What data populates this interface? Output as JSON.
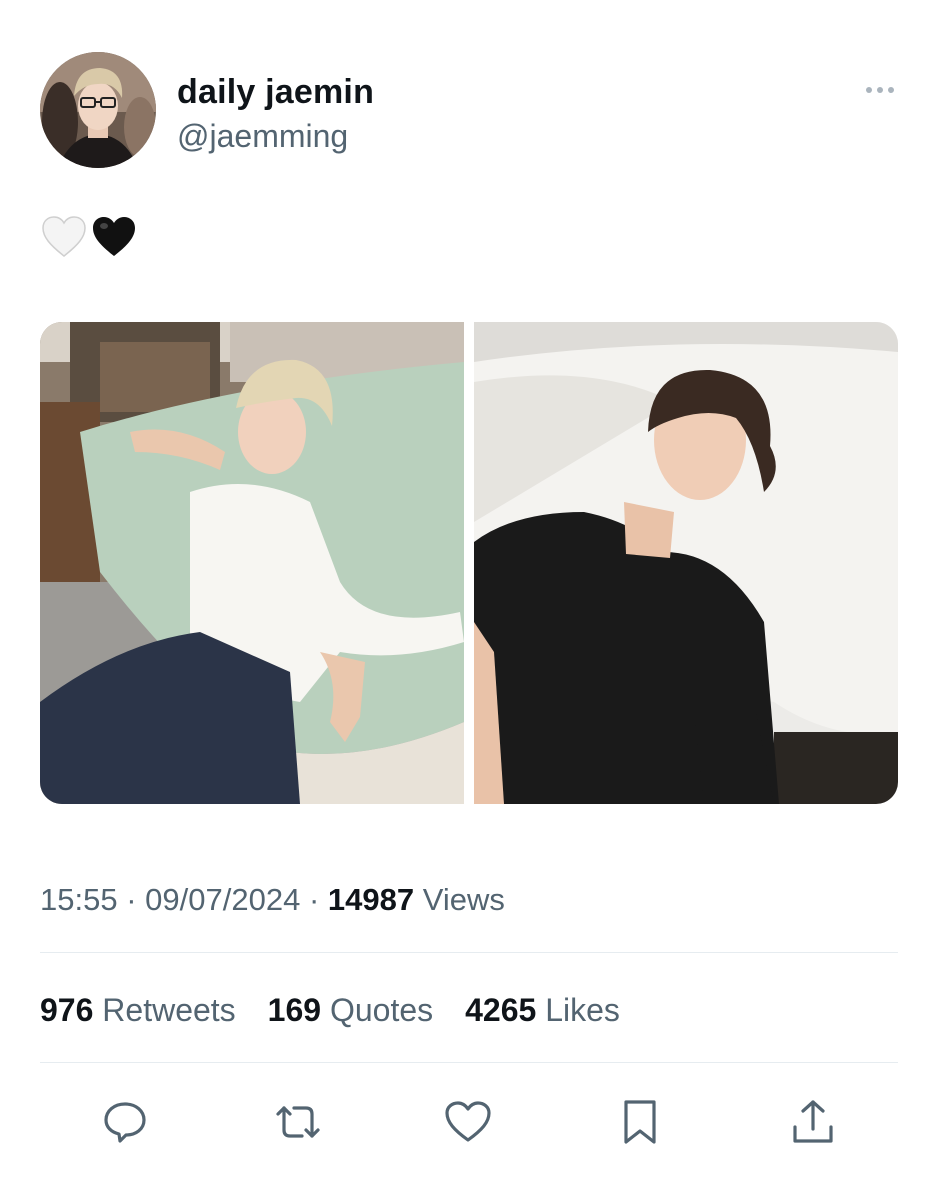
{
  "user": {
    "display_name": "daily jaemin",
    "handle": "@jaemming"
  },
  "tweet": {
    "text": "🤍🖤",
    "emojis": [
      "white-heart",
      "black-heart"
    ]
  },
  "media": [
    {
      "name": "photo-1"
    },
    {
      "name": "photo-2"
    }
  ],
  "meta": {
    "time": "15:55",
    "separator": "·",
    "date": "09/07/2024",
    "views_count": "14987",
    "views_label": "Views"
  },
  "stats": {
    "retweets_count": "976",
    "retweets_label": "Retweets",
    "quotes_count": "169",
    "quotes_label": "Quotes",
    "likes_count": "4265",
    "likes_label": "Likes"
  },
  "actions": [
    "reply-icon",
    "retweet-icon",
    "like-icon",
    "bookmark-icon",
    "share-icon"
  ],
  "colors": {
    "text_primary": "#0f1419",
    "text_secondary": "#536471",
    "divider": "#e6ecf0",
    "icon": "#536471"
  }
}
